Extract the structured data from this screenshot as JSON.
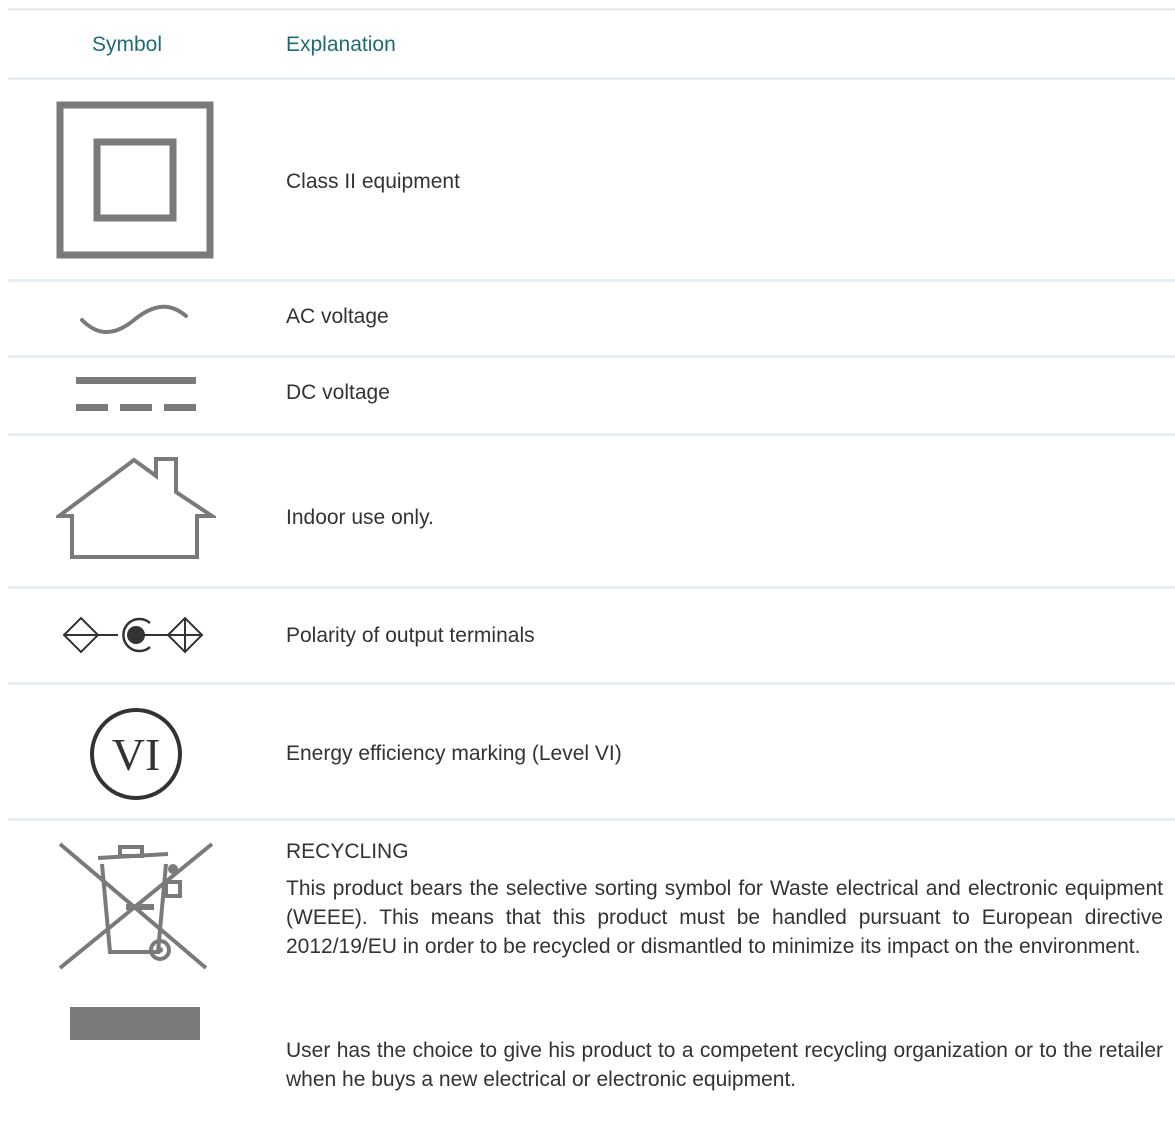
{
  "header": {
    "symbol": "Symbol",
    "explanation": "Explanation"
  },
  "rows": [
    {
      "icon": "class-ii-equipment-icon",
      "text": "Class II equipment"
    },
    {
      "icon": "ac-voltage-icon",
      "text": "AC voltage"
    },
    {
      "icon": "dc-voltage-icon",
      "text": "DC voltage"
    },
    {
      "icon": "indoor-use-house-icon",
      "text": "Indoor use only."
    },
    {
      "icon": "polarity-terminals-icon",
      "text": "Polarity of output terminals"
    },
    {
      "icon": "energy-efficiency-vi-icon",
      "text": "Energy efficiency marking (Level VI)",
      "symbol_text": "VI"
    },
    {
      "icon": "crossed-out-bin-icon",
      "text": "RECYCLING"
    }
  ],
  "recycling": {
    "paragraph1": "This product bears the selective sorting symbol for Waste electrical and electronic equipment (WEEE). This means that this product must be handled pursuant to European directive 2012/19/EU in order to be recycled or dismantled to minimize its impact on the environment.",
    "paragraph2": "User has the choice to give his product to a competent recycling organization or to the retailer when he buys a new electrical or electronic equipment."
  },
  "colors": {
    "header_text": "#1f6b75",
    "body_text": "#333333",
    "rule": "#e8eef1",
    "symbol_gray": "#7a7a7a",
    "symbol_dark": "#333333"
  }
}
